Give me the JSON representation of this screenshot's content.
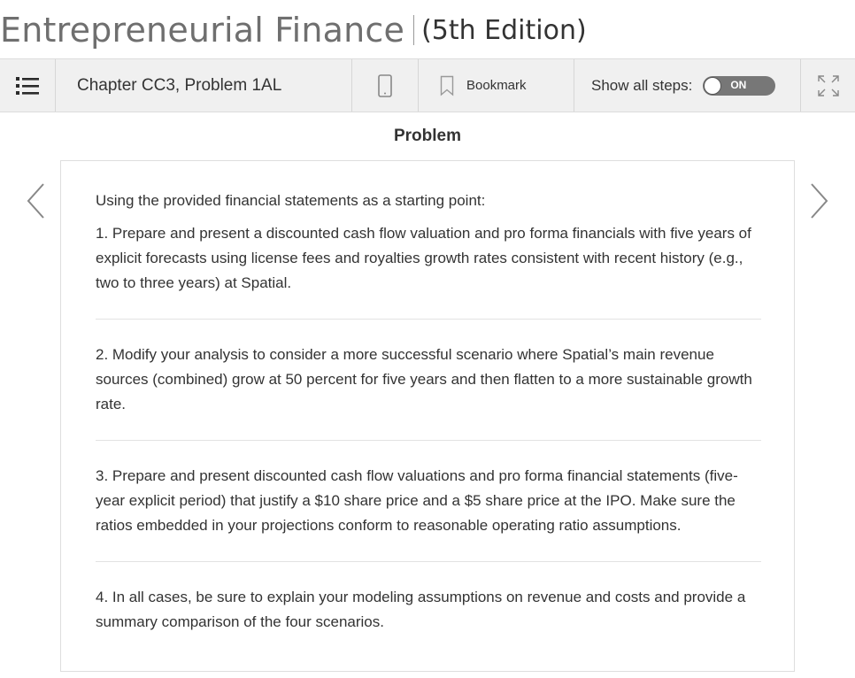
{
  "book": {
    "title": "Entrepreneurial Finance",
    "edition": "(5th Edition)"
  },
  "toolbar": {
    "chapter_label": "Chapter CC3, Problem 1AL",
    "bookmark_label": "Bookmark",
    "show_steps_label": "Show all steps:",
    "toggle_state": "ON"
  },
  "section": {
    "heading": "Problem"
  },
  "problem": {
    "intro": "Using the provided financial statements as a starting point:",
    "items": [
      "1. Prepare and present a discounted cash flow valuation and pro forma financials with five years of explicit forecasts using license fees and royalties growth rates consistent with recent history (e.g., two to three years) at Spatial.",
      "2. Modify your analysis to consider a more successful scenario where Spatial’s main revenue sources (combined) grow at 50 percent for five years and then flatten to a more sustainable growth rate.",
      "3. Prepare and present discounted cash flow valuations and pro forma financial statements (five-year explicit period) that justify a $10 share price and a $5 share price at the IPO. Make sure the ratios embedded in your projections conform to reasonable operating ratio assumptions.",
      "4. In all cases, be sure to explain your modeling assumptions on revenue and costs and provide a summary comparison of the four scenarios."
    ]
  },
  "icons": {
    "list": "list-icon",
    "mobile": "mobile-phone-icon",
    "bookmark": "bookmark-icon",
    "expand": "expand-icon",
    "prev": "chevron-left-icon",
    "next": "chevron-right-icon"
  },
  "colors": {
    "toolbar_bg": "#f0f0f0",
    "toggle_bg": "#777777",
    "title_gray": "#6f6f6f",
    "text": "#333333"
  }
}
